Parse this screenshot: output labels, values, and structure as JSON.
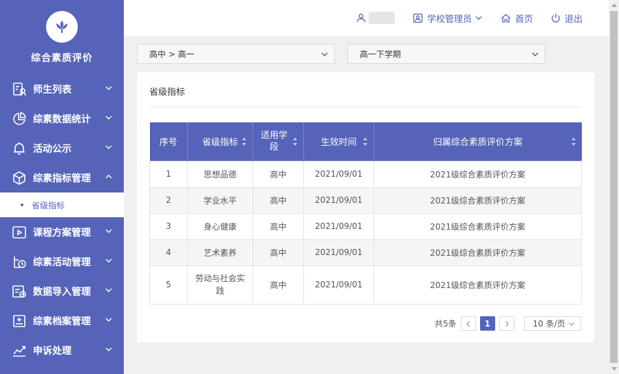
{
  "app": {
    "title": "综合素质评价"
  },
  "sidebar": {
    "items": [
      {
        "label": "师生列表",
        "icon": "teacher-student-icon"
      },
      {
        "label": "综素数据统计",
        "icon": "pie-chart-icon"
      },
      {
        "label": "活动公示",
        "icon": "bell-icon"
      },
      {
        "label": "综素指标管理",
        "icon": "cube-icon"
      },
      {
        "label": "课程方案管理",
        "icon": "play-icon"
      },
      {
        "label": "综素活动管理",
        "icon": "activity-icon"
      },
      {
        "label": "数据导入管理",
        "icon": "import-icon"
      },
      {
        "label": "综素档案管理",
        "icon": "archive-icon"
      },
      {
        "label": "申诉处理",
        "icon": "trend-icon"
      }
    ],
    "sub_item": {
      "label": "省级指标"
    }
  },
  "header": {
    "role_label": "学校管理员",
    "home_label": "首页",
    "logout_label": "退出"
  },
  "filters": {
    "grade": "高中 > 高一",
    "semester": "高一下学期"
  },
  "card": {
    "title": "省级指标"
  },
  "table": {
    "headers": [
      "序号",
      "省级指标",
      "适用学段",
      "生效时间",
      "归属综合素质评价方案"
    ],
    "rows": [
      [
        "1",
        "思想品德",
        "高中",
        "2021/09/01",
        "2021级综合素质评价方案"
      ],
      [
        "2",
        "学业水平",
        "高中",
        "2021/09/01",
        "2021级综合素质评价方案"
      ],
      [
        "3",
        "身心健康",
        "高中",
        "2021/09/01",
        "2021级综合素质评价方案"
      ],
      [
        "4",
        "艺术素养",
        "高中",
        "2021/09/01",
        "2021级综合素质评价方案"
      ],
      [
        "5",
        "劳动与社会实践",
        "高中",
        "2021/09/01",
        "2021级综合素质评价方案"
      ]
    ]
  },
  "pagination": {
    "total": "共5条",
    "current_page": "1",
    "page_size": "10 条/页"
  },
  "colors": {
    "brand": "#5563b8"
  }
}
